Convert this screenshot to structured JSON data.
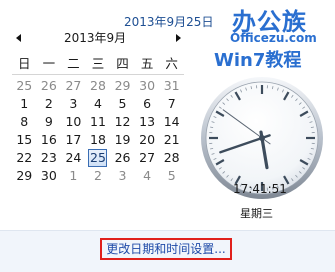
{
  "header": {
    "date_text": "2013年9月25日"
  },
  "watermark": {
    "logo_cn": "办公族",
    "url": "Officezu.com",
    "tagline": "Win7教程"
  },
  "calendar": {
    "month_title": "2013年9月",
    "weekdays": [
      "日",
      "一",
      "二",
      "三",
      "四",
      "五",
      "六"
    ],
    "weeks": [
      [
        {
          "d": "25",
          "o": true
        },
        {
          "d": "26",
          "o": true
        },
        {
          "d": "27",
          "o": true
        },
        {
          "d": "28",
          "o": true
        },
        {
          "d": "29",
          "o": true
        },
        {
          "d": "30",
          "o": true
        },
        {
          "d": "31",
          "o": true
        }
      ],
      [
        {
          "d": "1"
        },
        {
          "d": "2"
        },
        {
          "d": "3"
        },
        {
          "d": "4"
        },
        {
          "d": "5"
        },
        {
          "d": "6"
        },
        {
          "d": "7"
        }
      ],
      [
        {
          "d": "8"
        },
        {
          "d": "9"
        },
        {
          "d": "10"
        },
        {
          "d": "11"
        },
        {
          "d": "12"
        },
        {
          "d": "13"
        },
        {
          "d": "14"
        }
      ],
      [
        {
          "d": "15"
        },
        {
          "d": "16"
        },
        {
          "d": "17"
        },
        {
          "d": "18"
        },
        {
          "d": "19"
        },
        {
          "d": "20"
        },
        {
          "d": "21"
        }
      ],
      [
        {
          "d": "22"
        },
        {
          "d": "23"
        },
        {
          "d": "24"
        },
        {
          "d": "25",
          "today": true
        },
        {
          "d": "26"
        },
        {
          "d": "27"
        },
        {
          "d": "28"
        }
      ],
      [
        {
          "d": "29"
        },
        {
          "d": "30"
        },
        {
          "d": "1",
          "o": true
        },
        {
          "d": "2",
          "o": true
        },
        {
          "d": "3",
          "o": true
        },
        {
          "d": "4",
          "o": true
        },
        {
          "d": "5",
          "o": true
        }
      ]
    ],
    "nav_prev_icon": "triangle-left-icon",
    "nav_next_icon": "triangle-right-icon"
  },
  "clock": {
    "hour": 17,
    "minute": 41,
    "second": 51,
    "time_text": "17:41:51",
    "weekday_text": "星期三"
  },
  "footer": {
    "change_link": "更改日期和时间设置..."
  },
  "colors": {
    "date_header": "#1e4f93",
    "link": "#1f4aa8",
    "highlight_border": "#e0201b",
    "today_border": "#3a6db3",
    "watermark": "#2a6fd0"
  }
}
